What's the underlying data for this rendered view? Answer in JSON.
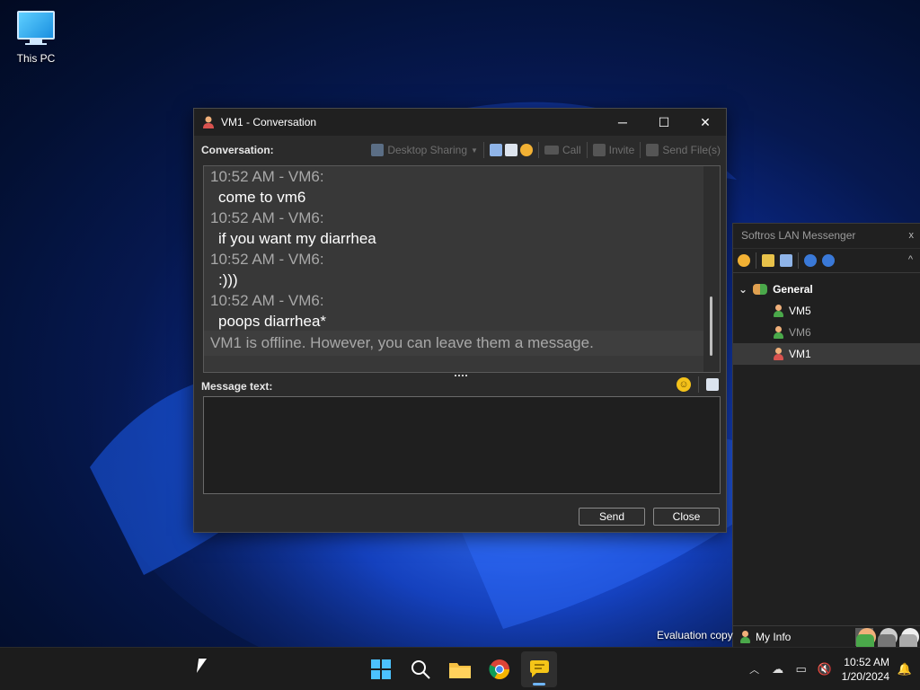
{
  "desktop": {
    "icons": [
      {
        "label": "This PC",
        "icon": "monitor-icon"
      }
    ],
    "eval_text": "Evaluation copy"
  },
  "conversation": {
    "title": "VM1 - Conversation",
    "window_buttons": {
      "minimize": "─",
      "maximize": "☐",
      "close": "✕"
    },
    "conversation_label": "Conversation:",
    "toolbar": {
      "desktop_sharing": "Desktop Sharing",
      "call": "Call",
      "invite": "Invite",
      "send_files": "Send File(s)"
    },
    "messages": [
      {
        "header": "10:52 AM - VM6:",
        "text": "come to vm6"
      },
      {
        "header": "10:52 AM - VM6:",
        "text": "if you want my diarrhea"
      },
      {
        "header": "10:52 AM - VM6:",
        "text": ":)))"
      },
      {
        "header": "10:52 AM - VM6:",
        "text": "poops diarrhea*"
      }
    ],
    "offline_notice": "VM1 is offline. However, you can leave them a message.",
    "message_label": "Message text:",
    "message_value": "",
    "send_button": "Send",
    "close_button": "Close"
  },
  "lan_messenger": {
    "title": "Softros LAN Messenger",
    "close": "x",
    "collapse": "^",
    "group": {
      "name": "General",
      "expand": "⌄"
    },
    "users": [
      {
        "name": "VM5",
        "status": "online",
        "color": "#ffffff"
      },
      {
        "name": "VM6",
        "status": "away",
        "color": "#9a9a9a"
      },
      {
        "name": "VM1",
        "status": "offline",
        "color": "#ffffff"
      }
    ],
    "my_info": "My Info"
  },
  "taskbar": {
    "apps": [
      "windows-start",
      "search",
      "file-explorer",
      "chrome",
      "softros-messenger"
    ],
    "clock_time": "10:52 AM",
    "clock_date": "1/20/2024"
  }
}
